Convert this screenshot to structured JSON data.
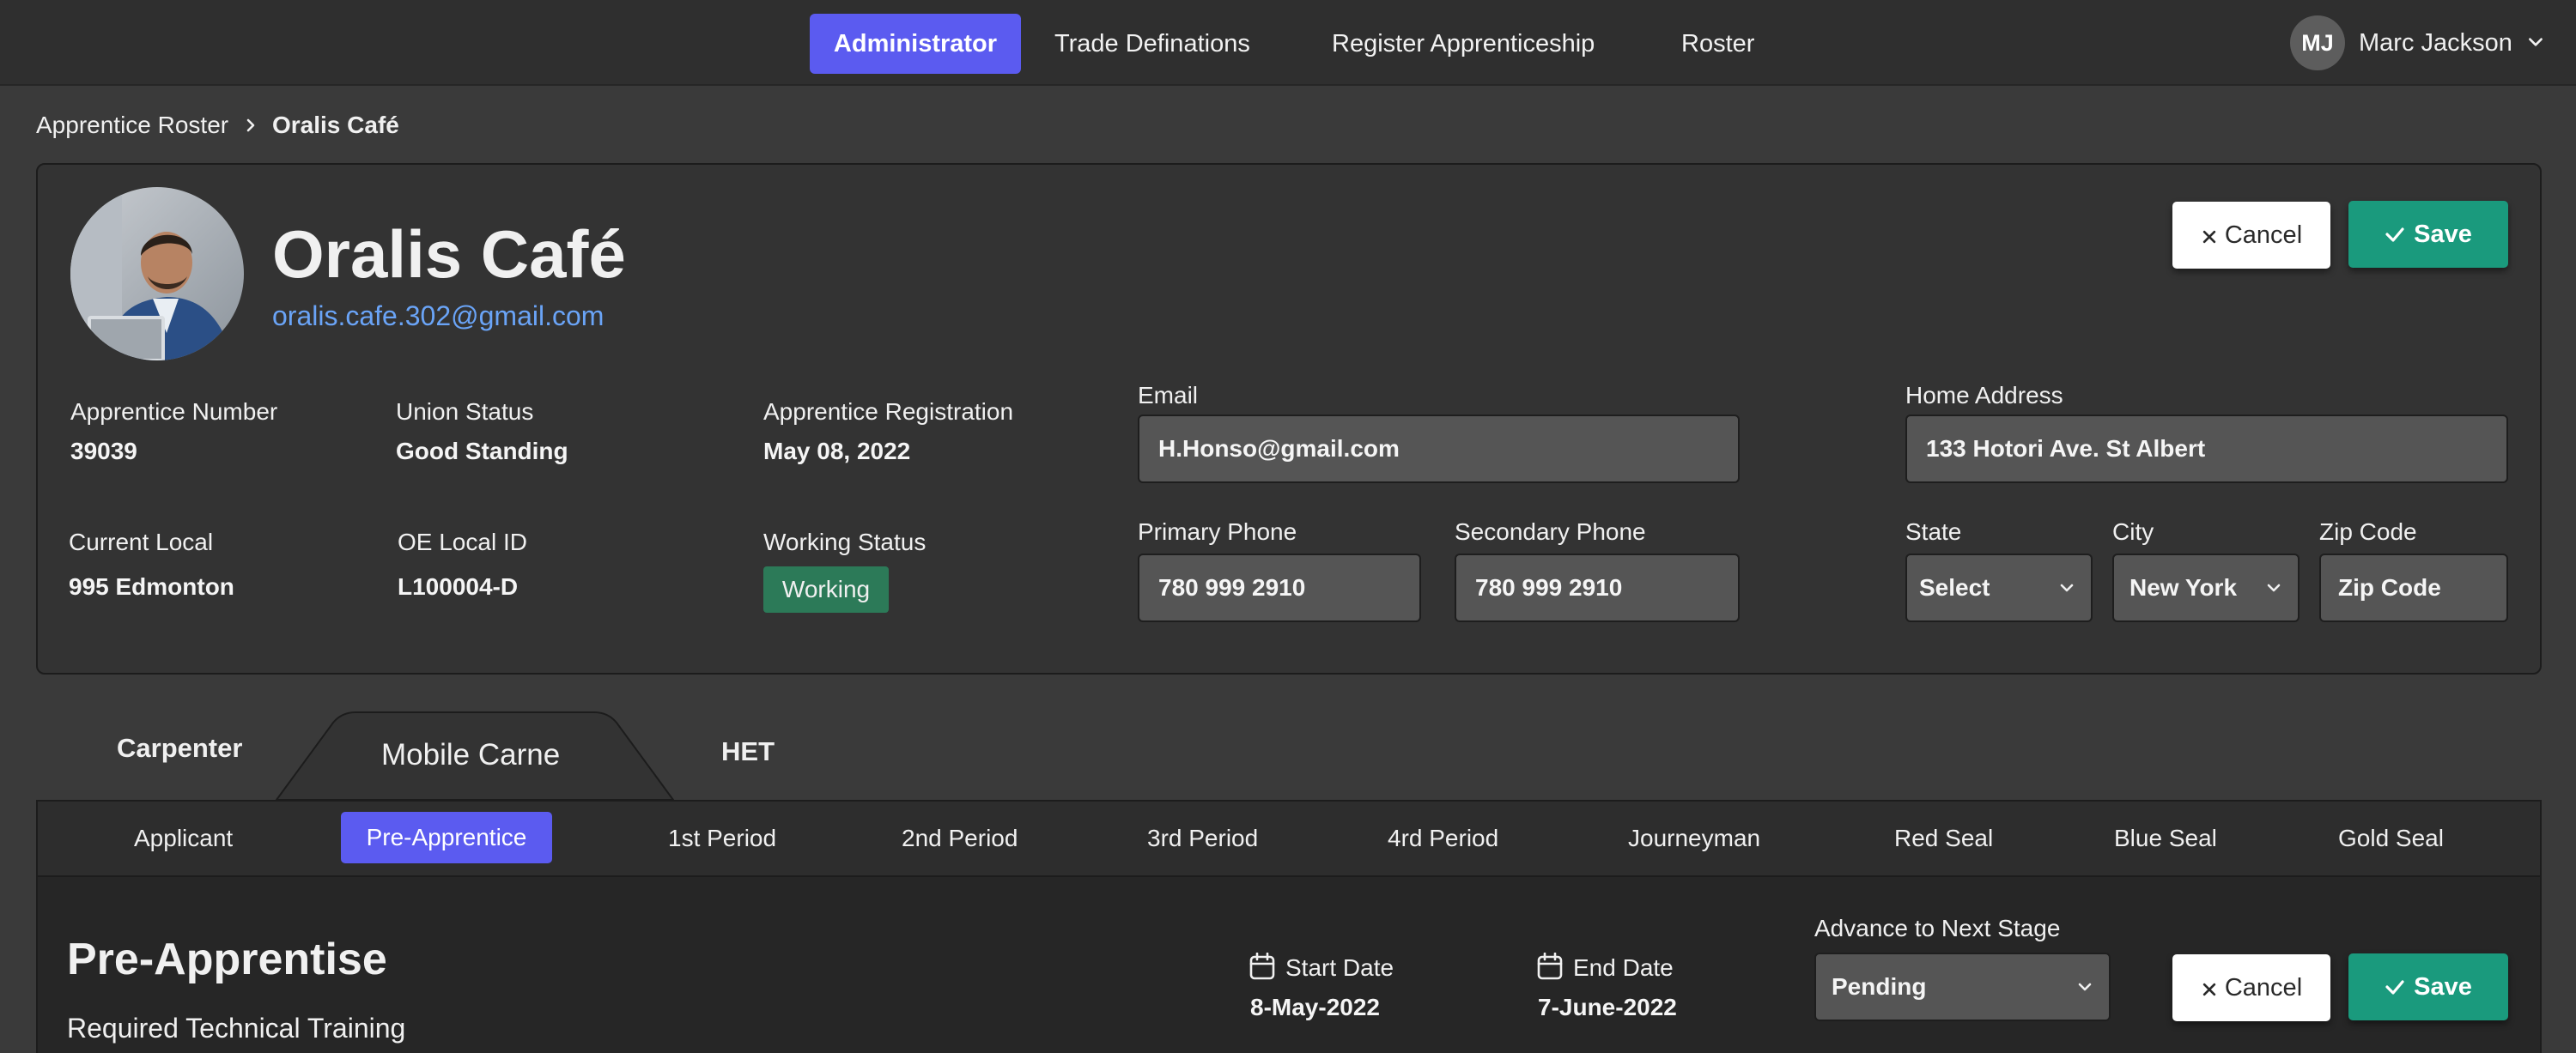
{
  "nav": {
    "items": [
      {
        "label": "Administrator",
        "active": true
      },
      {
        "label": "Trade Definations",
        "active": false
      },
      {
        "label": "Register Apprenticeship",
        "active": false
      },
      {
        "label": "Roster",
        "active": false
      }
    ],
    "user": {
      "initials": "MJ",
      "name": "Marc Jackson"
    }
  },
  "breadcrumb": {
    "parent": "Apprentice Roster",
    "current": "Oralis Café"
  },
  "profile": {
    "name": "Oralis Café",
    "email": "oralis.cafe.302@gmail.com",
    "cancel_label": "Cancel",
    "save_label": "Save"
  },
  "details": {
    "apprentice_number": {
      "label": "Apprentice Number",
      "value": "39039"
    },
    "union_status": {
      "label": "Union Status",
      "value": "Good Standing"
    },
    "apprentice_registration": {
      "label": "Apprentice Registration",
      "value": "May 08, 2022"
    },
    "current_local": {
      "label": "Current Local",
      "value": "995 Edmonton"
    },
    "oe_local_id": {
      "label": "OE Local ID",
      "value": "L100004-D"
    },
    "working_status": {
      "label": "Working Status",
      "value": "Working"
    }
  },
  "contact": {
    "email": {
      "label": "Email",
      "value": "H.Honso@gmail.com"
    },
    "primary_phone": {
      "label": "Primary Phone",
      "value": "780 999 2910"
    },
    "secondary_phone": {
      "label": "Secondary Phone",
      "value": "780 999 2910"
    },
    "home_address": {
      "label": "Home Address",
      "value": "133 Hotori Ave. St Albert"
    },
    "state": {
      "label": "State",
      "value": "Select"
    },
    "city": {
      "label": "City",
      "value": "New York"
    },
    "zip": {
      "label": "Zip Code",
      "placeholder": "Zip Code"
    }
  },
  "trade_tabs": [
    {
      "label": "Carpenter",
      "active": false
    },
    {
      "label": "Mobile Carne",
      "active": true
    },
    {
      "label": "HET",
      "active": false
    }
  ],
  "stages": [
    {
      "label": "Applicant",
      "active": false
    },
    {
      "label": "Pre-Apprentice",
      "active": true
    },
    {
      "label": "1st Period",
      "active": false
    },
    {
      "label": "2nd Period",
      "active": false
    },
    {
      "label": "3rd Period",
      "active": false
    },
    {
      "label": "4rd Period",
      "active": false
    },
    {
      "label": "Journeyman",
      "active": false
    },
    {
      "label": "Red Seal",
      "active": false
    },
    {
      "label": "Blue Seal",
      "active": false
    },
    {
      "label": "Gold Seal",
      "active": false
    }
  ],
  "stage_detail": {
    "title": "Pre-Apprentise",
    "subtitle": "Required Technical Training",
    "start_date": {
      "label": "Start Date",
      "value": "8-May-2022"
    },
    "end_date": {
      "label": "End Date",
      "value": "7-June-2022"
    },
    "advance": {
      "label": "Advance to Next Stage",
      "value": "Pending"
    },
    "cancel_label": "Cancel",
    "save_label": "Save"
  },
  "icons": {
    "cancel": "close-icon",
    "save": "check-icon",
    "dropdown": "chevron-down-icon",
    "breadcrumb_separator": "chevron-right-icon",
    "date": "calendar-icon"
  },
  "colors": {
    "accent": "#5b5bf0",
    "save": "#1a9a7d",
    "link": "#6aa4f7",
    "working_badge": "#2c7a58"
  }
}
